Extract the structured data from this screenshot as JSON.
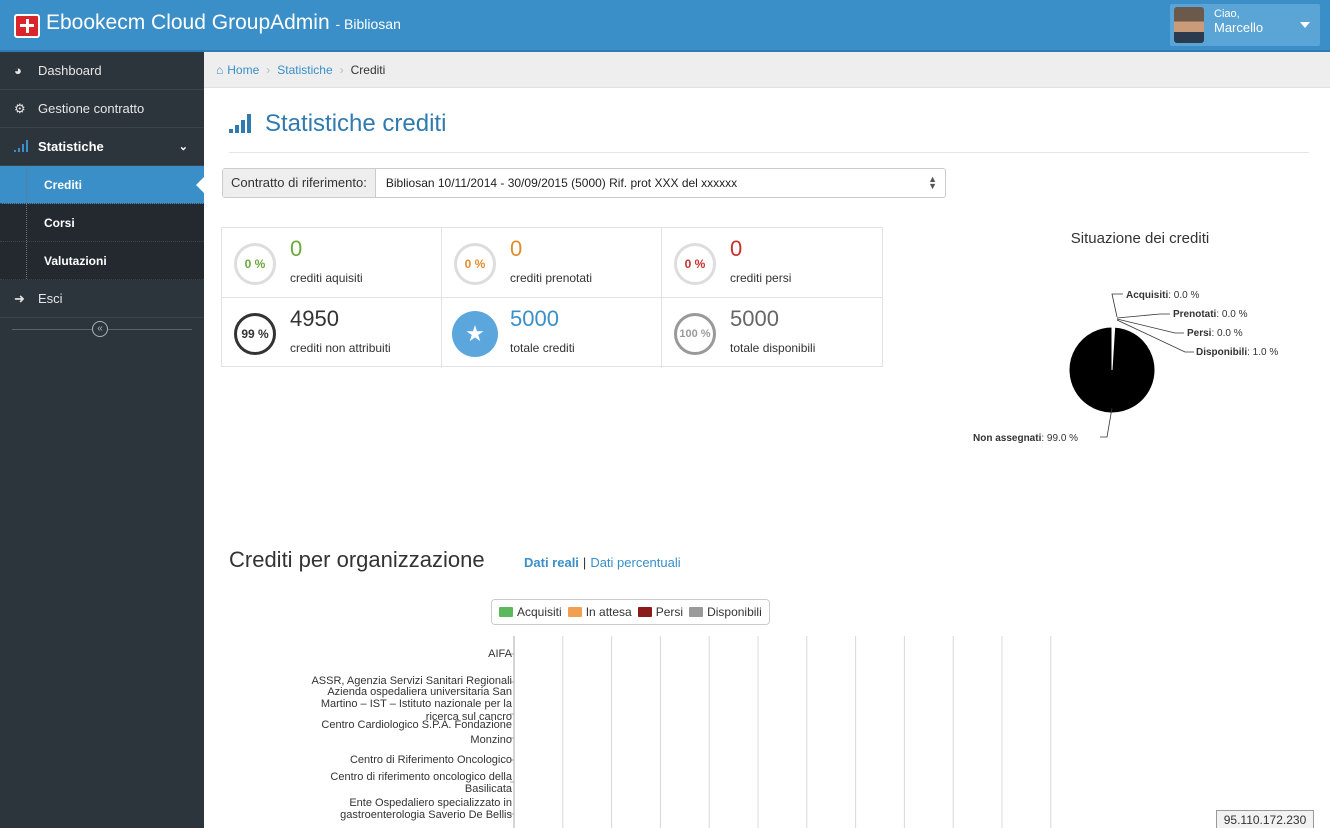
{
  "header": {
    "app_name": "Ebookecm Cloud GroupAdmin",
    "org_suffix": "- Bibliosan",
    "greeting": "Ciao,",
    "user_name": "Marcello"
  },
  "sidebar": {
    "items": [
      {
        "label": "Dashboard",
        "icon": "dashboard-icon"
      },
      {
        "label": "Gestione contratto",
        "icon": "cogs-icon"
      },
      {
        "label": "Statistiche",
        "icon": "bar-chart-icon"
      }
    ],
    "sub_items": [
      "Crediti",
      "Corsi",
      "Valutazioni"
    ],
    "exit": {
      "label": "Esci",
      "icon": "sign-out-icon"
    }
  },
  "breadcrumb": {
    "home": "Home",
    "section": "Statistiche",
    "current": "Crediti"
  },
  "page": {
    "title": "Statistiche crediti"
  },
  "contract": {
    "label": "Contratto di riferimento:",
    "value": "Bibliosan 10/11/2014 - 30/09/2015 (5000) Rif. prot XXX del xxxxxx"
  },
  "stats": [
    {
      "pct": "0 %",
      "value": "0",
      "label": "crediti aquisiti",
      "color": "#6aaa3a"
    },
    {
      "pct": "0 %",
      "value": "0",
      "label": "crediti prenotati",
      "color": "#e08e2c"
    },
    {
      "pct": "0 %",
      "value": "0",
      "label": "crediti persi",
      "color": "#c9302c"
    },
    {
      "pct": "99 %",
      "value": "4950",
      "label": "crediti non attribuiti",
      "color": "#333333"
    },
    {
      "pct": "",
      "value": "5000",
      "label": "totale crediti",
      "color": "#3a8fc8"
    },
    {
      "pct": "100 %",
      "value": "5000",
      "label": "totale disponibili",
      "color": "#888888"
    }
  ],
  "pie": {
    "title": "Situazione dei crediti",
    "labels": [
      {
        "name": "Acquisiti",
        "value": ": 0.0 %"
      },
      {
        "name": "Prenotati",
        "value": ": 0.0 %"
      },
      {
        "name": "Persi",
        "value": ": 0.0 %"
      },
      {
        "name": "Disponibili",
        "value": ": 1.0 %"
      },
      {
        "name": "Non assegnati",
        "value": ": 99.0 %"
      }
    ]
  },
  "chart_data": [
    {
      "type": "pie",
      "title": "Situazione dei crediti",
      "categories": [
        "Acquisiti",
        "Prenotati",
        "Persi",
        "Disponibili",
        "Non assegnati"
      ],
      "values": [
        0.0,
        0.0,
        0.0,
        1.0,
        99.0
      ]
    },
    {
      "type": "bar",
      "categories": [
        "AIFA",
        "ASSR, Agenzia Servizi Sanitari Regionali",
        "Azienda ospedaliera universitaria San Martino – IST – Istituto nazionale per la ricerca sul cancro",
        "Centro Cardiologico S.P.A. Fondazione Monzino",
        "Centro di Riferimento Oncologico",
        "Centro di riferimento oncologico della Basilicata",
        "Ente Ospedaliero specializzato in gastroenterologia Saverio De Bellis"
      ],
      "series": [
        {
          "name": "Acquisiti",
          "values": [
            0,
            0,
            0,
            0,
            0,
            0,
            0
          ]
        },
        {
          "name": "In attesa",
          "values": [
            0,
            0,
            0,
            0,
            0,
            0,
            0
          ]
        },
        {
          "name": "Persi",
          "values": [
            0,
            0,
            0,
            0,
            0,
            0,
            0
          ]
        },
        {
          "name": "Disponibili",
          "values": [
            0,
            0,
            0,
            0,
            0,
            0,
            0
          ]
        }
      ],
      "legend_position": "top"
    }
  ],
  "org": {
    "title": "Crediti per organizzazione",
    "link_real": "Dati reali",
    "link_pct": "Dati percentuali",
    "legend": [
      {
        "name": "Acquisiti",
        "color": "#5cb85c"
      },
      {
        "name": "In attesa",
        "color": "#f0a050"
      },
      {
        "name": "Persi",
        "color": "#8b1a1a"
      },
      {
        "name": "Disponibili",
        "color": "#999999"
      }
    ],
    "labels": [
      "AIFA",
      "ASSR, Agenzia Servizi Sanitari Regionali",
      "Azienda ospedaliera universitaria San",
      "Martino – IST – Istituto nazionale per la",
      "ricerca sul cancro",
      "Centro Cardiologico S.P.A. Fondazione",
      "Monzino",
      "Centro di Riferimento Oncologico",
      "Centro di riferimento oncologico della",
      "Basilicata",
      "Ente Ospedaliero specializzato in",
      "gastroenterologia Saverio De Bellis"
    ]
  },
  "footer": {
    "ip": "95.110.172.230"
  }
}
